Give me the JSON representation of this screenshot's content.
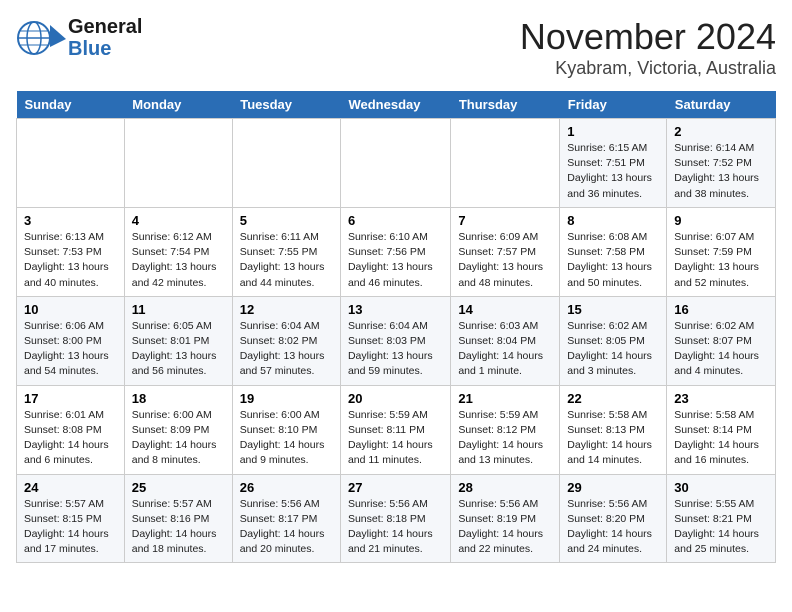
{
  "logo": {
    "line1": "General",
    "line2": "Blue"
  },
  "title": "November 2024",
  "subtitle": "Kyabram, Victoria, Australia",
  "headers": [
    "Sunday",
    "Monday",
    "Tuesday",
    "Wednesday",
    "Thursday",
    "Friday",
    "Saturday"
  ],
  "weeks": [
    [
      {
        "day": "",
        "info": ""
      },
      {
        "day": "",
        "info": ""
      },
      {
        "day": "",
        "info": ""
      },
      {
        "day": "",
        "info": ""
      },
      {
        "day": "",
        "info": ""
      },
      {
        "day": "1",
        "info": "Sunrise: 6:15 AM\nSunset: 7:51 PM\nDaylight: 13 hours\nand 36 minutes."
      },
      {
        "day": "2",
        "info": "Sunrise: 6:14 AM\nSunset: 7:52 PM\nDaylight: 13 hours\nand 38 minutes."
      }
    ],
    [
      {
        "day": "3",
        "info": "Sunrise: 6:13 AM\nSunset: 7:53 PM\nDaylight: 13 hours\nand 40 minutes."
      },
      {
        "day": "4",
        "info": "Sunrise: 6:12 AM\nSunset: 7:54 PM\nDaylight: 13 hours\nand 42 minutes."
      },
      {
        "day": "5",
        "info": "Sunrise: 6:11 AM\nSunset: 7:55 PM\nDaylight: 13 hours\nand 44 minutes."
      },
      {
        "day": "6",
        "info": "Sunrise: 6:10 AM\nSunset: 7:56 PM\nDaylight: 13 hours\nand 46 minutes."
      },
      {
        "day": "7",
        "info": "Sunrise: 6:09 AM\nSunset: 7:57 PM\nDaylight: 13 hours\nand 48 minutes."
      },
      {
        "day": "8",
        "info": "Sunrise: 6:08 AM\nSunset: 7:58 PM\nDaylight: 13 hours\nand 50 minutes."
      },
      {
        "day": "9",
        "info": "Sunrise: 6:07 AM\nSunset: 7:59 PM\nDaylight: 13 hours\nand 52 minutes."
      }
    ],
    [
      {
        "day": "10",
        "info": "Sunrise: 6:06 AM\nSunset: 8:00 PM\nDaylight: 13 hours\nand 54 minutes."
      },
      {
        "day": "11",
        "info": "Sunrise: 6:05 AM\nSunset: 8:01 PM\nDaylight: 13 hours\nand 56 minutes."
      },
      {
        "day": "12",
        "info": "Sunrise: 6:04 AM\nSunset: 8:02 PM\nDaylight: 13 hours\nand 57 minutes."
      },
      {
        "day": "13",
        "info": "Sunrise: 6:04 AM\nSunset: 8:03 PM\nDaylight: 13 hours\nand 59 minutes."
      },
      {
        "day": "14",
        "info": "Sunrise: 6:03 AM\nSunset: 8:04 PM\nDaylight: 14 hours\nand 1 minute."
      },
      {
        "day": "15",
        "info": "Sunrise: 6:02 AM\nSunset: 8:05 PM\nDaylight: 14 hours\nand 3 minutes."
      },
      {
        "day": "16",
        "info": "Sunrise: 6:02 AM\nSunset: 8:07 PM\nDaylight: 14 hours\nand 4 minutes."
      }
    ],
    [
      {
        "day": "17",
        "info": "Sunrise: 6:01 AM\nSunset: 8:08 PM\nDaylight: 14 hours\nand 6 minutes."
      },
      {
        "day": "18",
        "info": "Sunrise: 6:00 AM\nSunset: 8:09 PM\nDaylight: 14 hours\nand 8 minutes."
      },
      {
        "day": "19",
        "info": "Sunrise: 6:00 AM\nSunset: 8:10 PM\nDaylight: 14 hours\nand 9 minutes."
      },
      {
        "day": "20",
        "info": "Sunrise: 5:59 AM\nSunset: 8:11 PM\nDaylight: 14 hours\nand 11 minutes."
      },
      {
        "day": "21",
        "info": "Sunrise: 5:59 AM\nSunset: 8:12 PM\nDaylight: 14 hours\nand 13 minutes."
      },
      {
        "day": "22",
        "info": "Sunrise: 5:58 AM\nSunset: 8:13 PM\nDaylight: 14 hours\nand 14 minutes."
      },
      {
        "day": "23",
        "info": "Sunrise: 5:58 AM\nSunset: 8:14 PM\nDaylight: 14 hours\nand 16 minutes."
      }
    ],
    [
      {
        "day": "24",
        "info": "Sunrise: 5:57 AM\nSunset: 8:15 PM\nDaylight: 14 hours\nand 17 minutes."
      },
      {
        "day": "25",
        "info": "Sunrise: 5:57 AM\nSunset: 8:16 PM\nDaylight: 14 hours\nand 18 minutes."
      },
      {
        "day": "26",
        "info": "Sunrise: 5:56 AM\nSunset: 8:17 PM\nDaylight: 14 hours\nand 20 minutes."
      },
      {
        "day": "27",
        "info": "Sunrise: 5:56 AM\nSunset: 8:18 PM\nDaylight: 14 hours\nand 21 minutes."
      },
      {
        "day": "28",
        "info": "Sunrise: 5:56 AM\nSunset: 8:19 PM\nDaylight: 14 hours\nand 22 minutes."
      },
      {
        "day": "29",
        "info": "Sunrise: 5:56 AM\nSunset: 8:20 PM\nDaylight: 14 hours\nand 24 minutes."
      },
      {
        "day": "30",
        "info": "Sunrise: 5:55 AM\nSunset: 8:21 PM\nDaylight: 14 hours\nand 25 minutes."
      }
    ]
  ]
}
